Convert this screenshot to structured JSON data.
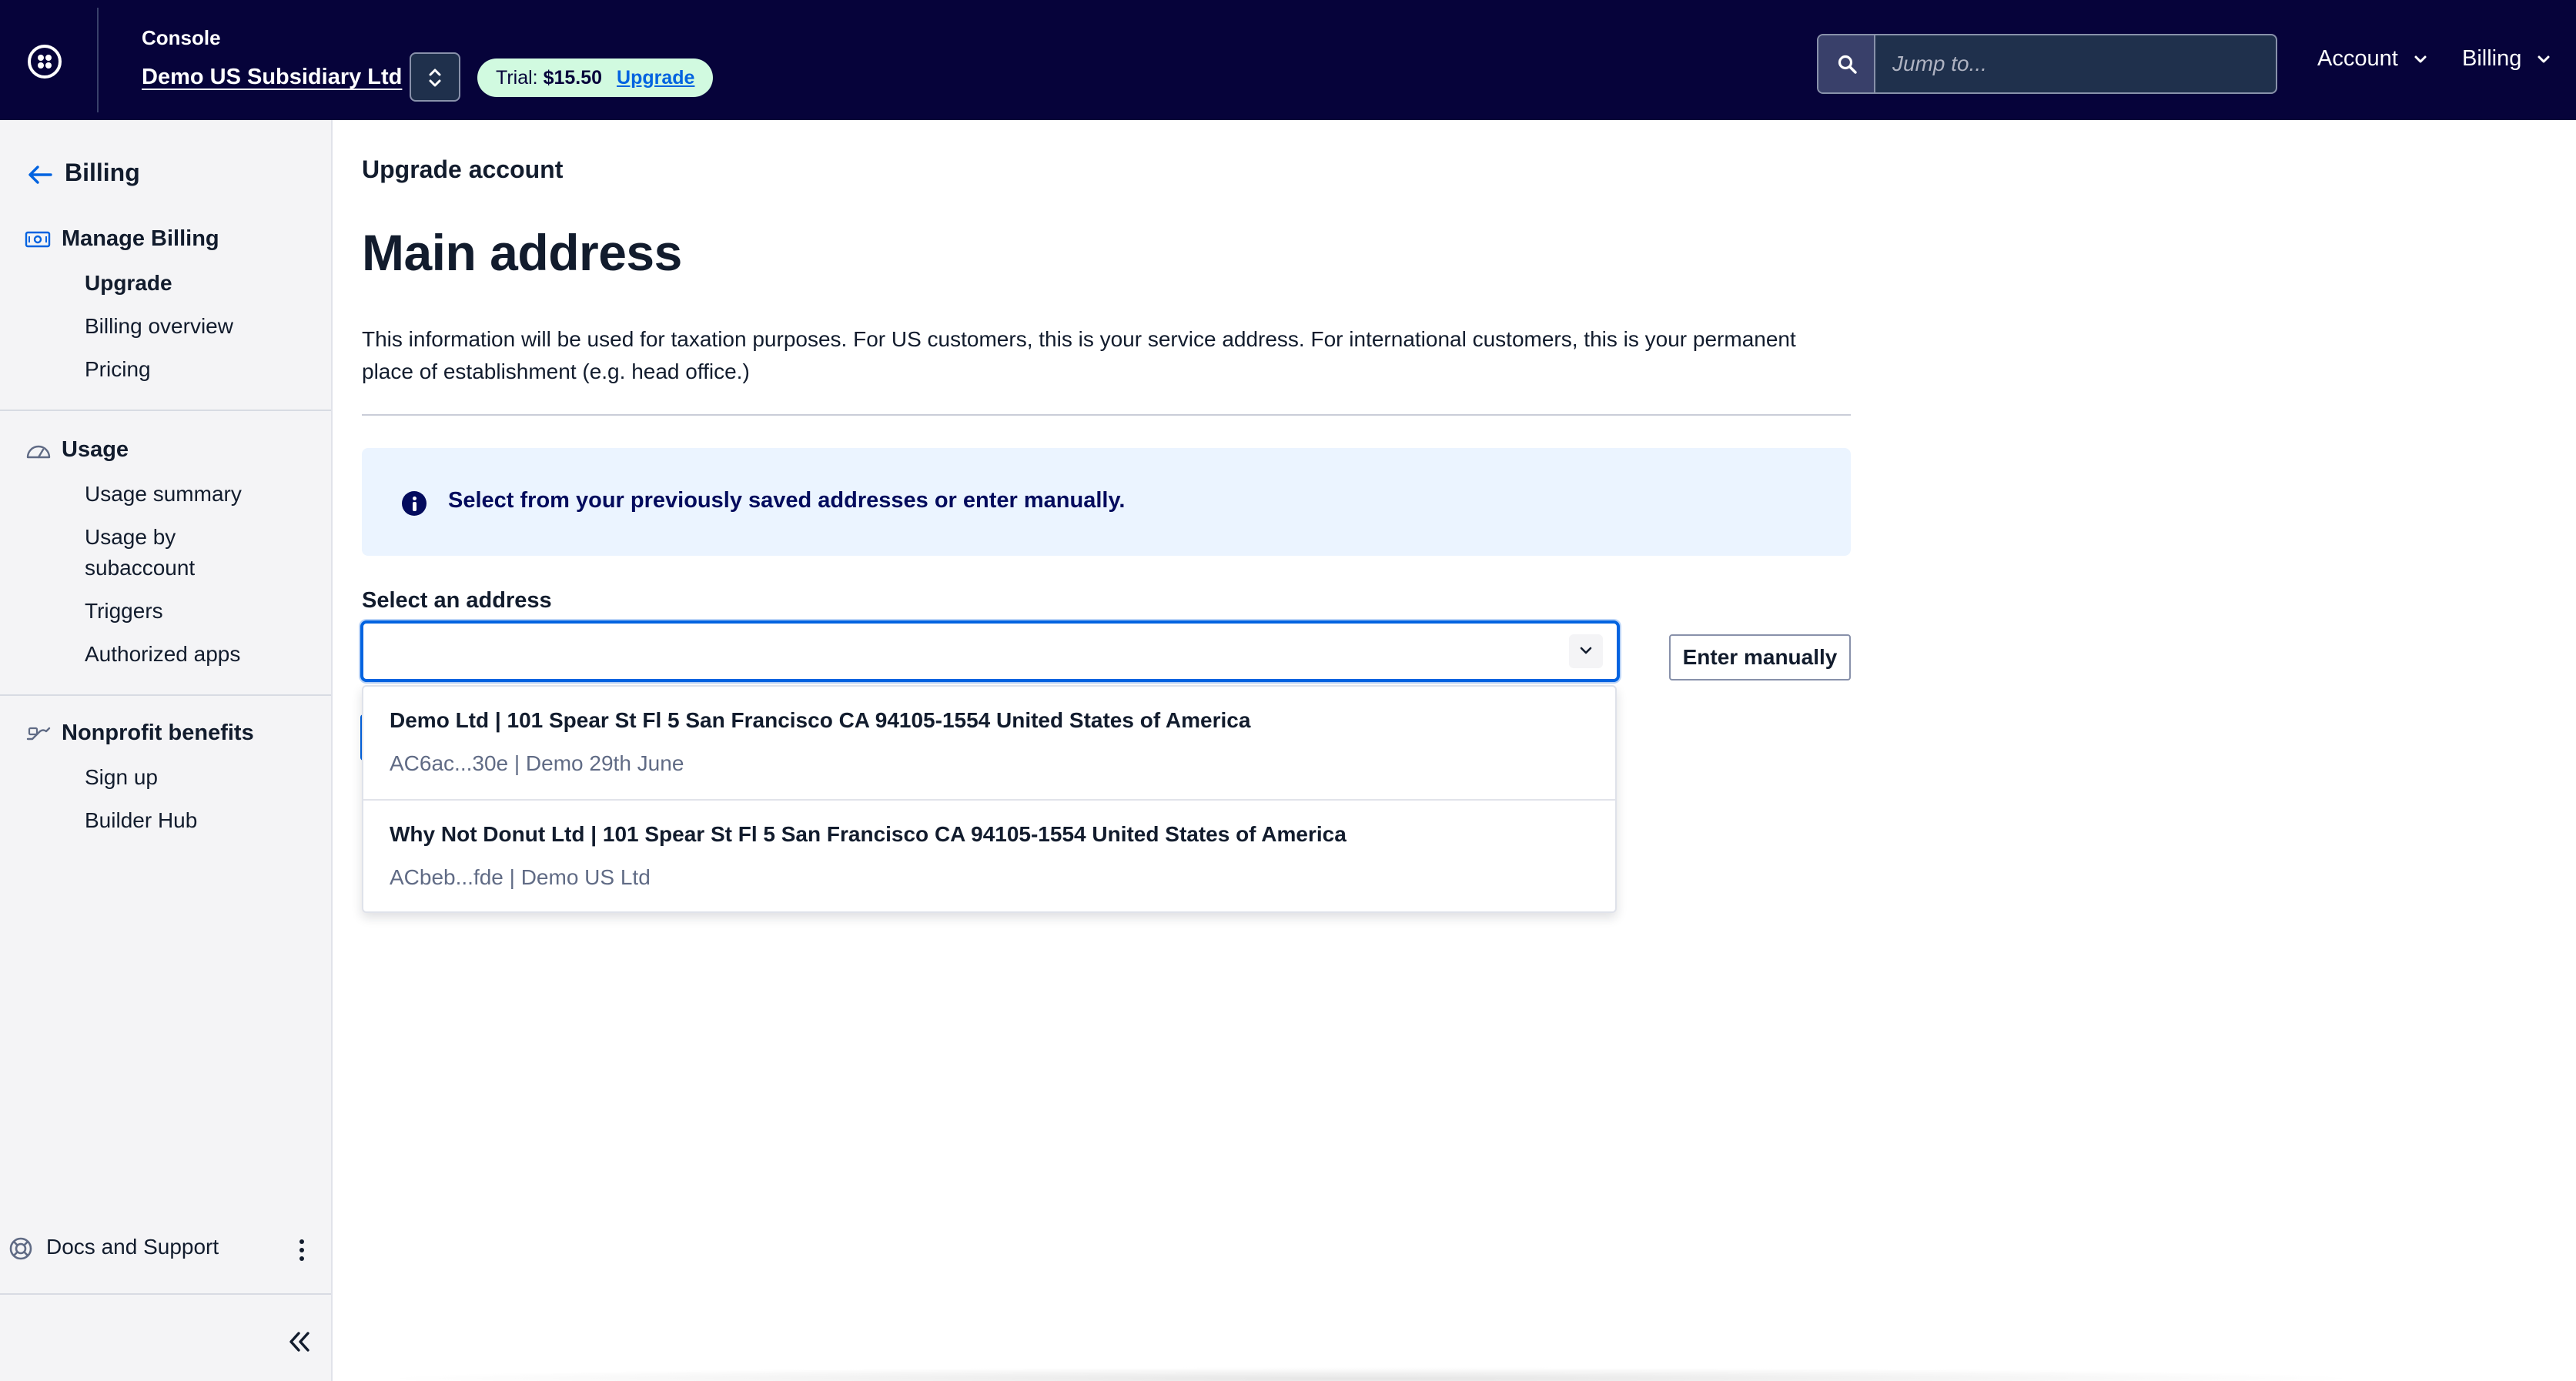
{
  "topbar": {
    "console_label": "Console",
    "account_name": "Demo US Subsidiary Ltd",
    "trial_label": "Trial:",
    "trial_amount": "$15.50",
    "upgrade_link": "Upgrade",
    "search_placeholder": "Jump to...",
    "account_menu": "Account",
    "billing_menu": "Billing"
  },
  "sidebar": {
    "back_label": "Billing",
    "sections": [
      {
        "title": "Manage Billing",
        "items": [
          "Upgrade",
          "Billing overview",
          "Pricing"
        ]
      },
      {
        "title": "Usage",
        "items": [
          "Usage summary",
          "Usage by subaccount",
          "Triggers",
          "Authorized apps"
        ]
      },
      {
        "title": "Nonprofit benefits",
        "items": [
          "Sign up",
          "Builder Hub"
        ]
      }
    ],
    "footer_label": "Docs and Support"
  },
  "main": {
    "breadcrumb": "Upgrade account",
    "title": "Main address",
    "description": "This information will be used for taxation purposes. For US customers, this is your service address. For international customers, this is your permanent place of establishment (e.g. head office.)",
    "info_message": "Select from your previously saved addresses or enter manually.",
    "select_label": "Select an address",
    "select_value": "",
    "enter_manually_label": "Enter manually",
    "options": [
      {
        "primary": "Demo Ltd | 101 Spear St Fl 5 San Francisco CA 94105-1554 United States of America",
        "secondary": "AC6ac...30e | Demo 29th June"
      },
      {
        "primary": "Why Not Donut Ltd | 101 Spear St Fl 5 San Francisco CA 94105-1554 United States of America",
        "secondary": "ACbeb...fde | Demo US Ltd"
      }
    ]
  },
  "colors": {
    "topbar_bg": "#06033a",
    "accent": "#0263e0",
    "info_bg": "#ebf4ff",
    "trial_pill_bg": "#d1fae0"
  },
  "icons": [
    "logo-icon",
    "chevron-up-down-icon",
    "search-icon",
    "chevron-down-icon",
    "arrow-left-icon",
    "billing-icon",
    "gauge-icon",
    "nonprofit-icon",
    "info-icon",
    "lifebuoy-icon",
    "kebab-icon",
    "double-chevron-left-icon"
  ]
}
